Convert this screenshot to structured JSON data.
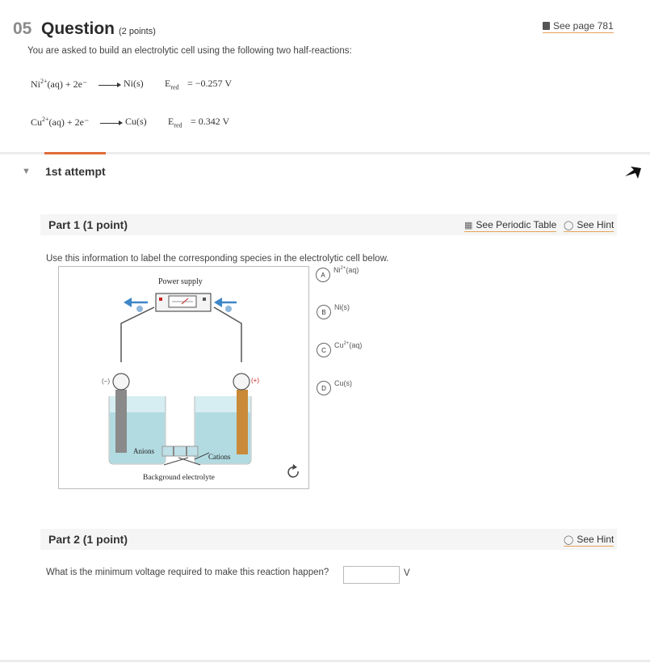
{
  "question": {
    "number": "05",
    "title": "Question",
    "points": "(2 points)",
    "see_page": "See page 781",
    "intro": "You are asked to build an electrolytic cell using the following two half-reactions:"
  },
  "reactions": [
    {
      "lhs_ion": "Ni",
      "lhs_charge": "2+",
      "lhs_rest": "(aq) + 2e⁻",
      "product": "Ni(s)",
      "e_label": "E",
      "e_sub": "red",
      "value": "= −0.257 V"
    },
    {
      "lhs_ion": "Cu",
      "lhs_charge": "2+",
      "lhs_rest": "(aq) + 2e⁻",
      "product": "Cu(s)",
      "e_label": "E",
      "e_sub": "red",
      "value": "= 0.342 V"
    }
  ],
  "attempt": {
    "label": "1st attempt"
  },
  "part1": {
    "title": "Part 1   (1 point)",
    "periodic_table": "See Periodic Table",
    "hint": "See Hint",
    "instruction": "Use this information to label the corresponding species in the electrolytic cell below.",
    "figure": {
      "power_supply": "Power supply",
      "neg_terminal": "(−)",
      "pos_terminal": "(+)",
      "anions": "Anions",
      "cations": "Cations",
      "electrolyte": "Background electrolyte"
    },
    "options": [
      {
        "letter": "A",
        "species": "Ni",
        "charge": "2+",
        "phase": "(aq)"
      },
      {
        "letter": "B",
        "species": "Ni(s)",
        "charge": "",
        "phase": ""
      },
      {
        "letter": "C",
        "species": "Cu",
        "charge": "2+",
        "phase": "(aq)"
      },
      {
        "letter": "D",
        "species": "Cu(s)",
        "charge": "",
        "phase": ""
      }
    ]
  },
  "part2": {
    "title": "Part 2   (1 point)",
    "hint": "See Hint",
    "question": "What is the minimum voltage required to make this reaction happen?",
    "answer_value": "",
    "unit": "V"
  },
  "colors": {
    "accent": "#e06b3a",
    "link_underline": "#e6a35a",
    "arrow_blue": "#3d87c8"
  }
}
